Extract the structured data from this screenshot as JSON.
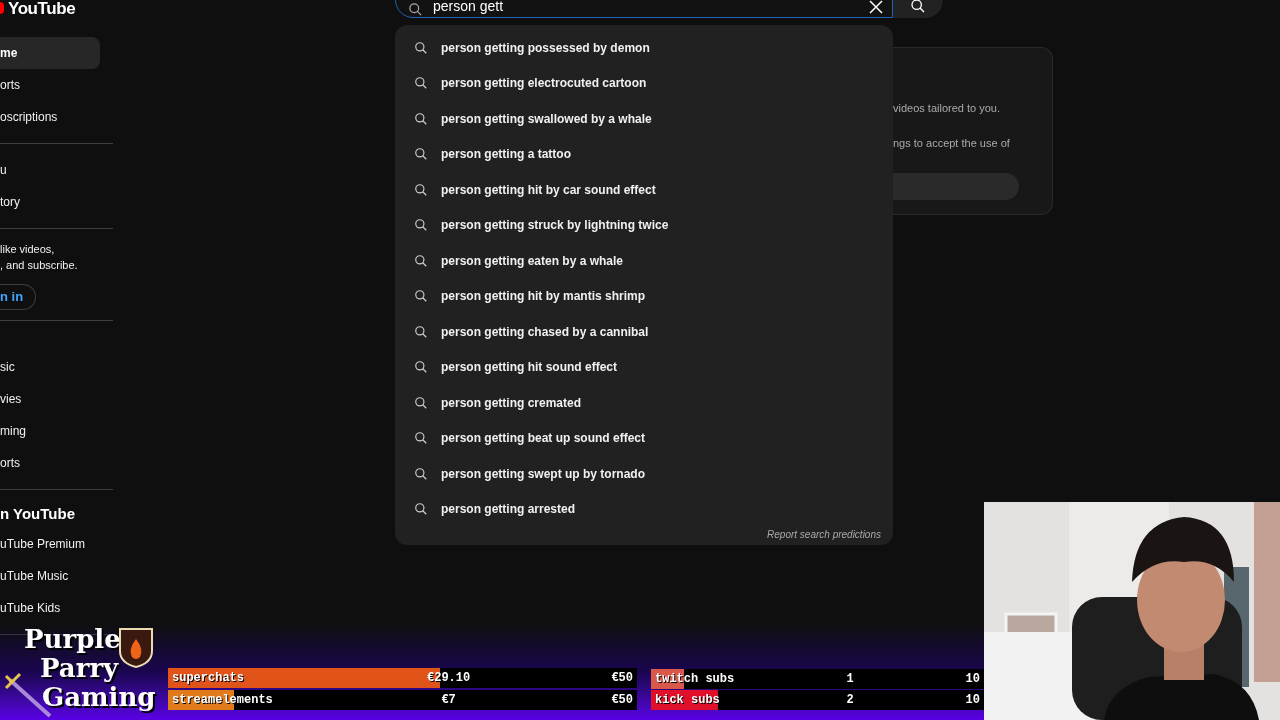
{
  "logo": {
    "text": "YouTube"
  },
  "sidebar": {
    "sections": [
      {
        "rows": [
          {
            "kind": "item",
            "label": "me",
            "selected": true
          },
          {
            "kind": "item",
            "label": "orts",
            "selected": false
          },
          {
            "kind": "item",
            "label": "oscriptions",
            "selected": false
          }
        ]
      },
      {
        "rows": [
          {
            "kind": "item",
            "label": "u",
            "selected": false
          },
          {
            "kind": "item",
            "label": "tory",
            "selected": false
          }
        ]
      },
      {
        "rows": [
          {
            "kind": "prompt",
            "label": "like videos,\n, and subscribe."
          },
          {
            "kind": "button",
            "label": "n in"
          }
        ]
      },
      {
        "rows": [
          {
            "kind": "item",
            "label": "sic",
            "selected": false
          },
          {
            "kind": "item",
            "label": "vies",
            "selected": false
          },
          {
            "kind": "item",
            "label": "ming",
            "selected": false
          },
          {
            "kind": "item",
            "label": "orts",
            "selected": false
          }
        ]
      },
      {
        "rows": [
          {
            "kind": "heading",
            "label": "n YouTube"
          },
          {
            "kind": "item",
            "label": "uTube Premium",
            "selected": false
          },
          {
            "kind": "item",
            "label": "uTube Music",
            "selected": false
          },
          {
            "kind": "item",
            "label": "uTube Kids",
            "selected": false
          }
        ]
      }
    ]
  },
  "search": {
    "value": "person gett"
  },
  "suggestions": [
    {
      "text": "person getting possessed by demon"
    },
    {
      "text": "person getting electrocuted cartoon"
    },
    {
      "text": "person getting swallowed by a whale"
    },
    {
      "text": "person getting a tattoo"
    },
    {
      "text": "person getting hit by car sound effect"
    },
    {
      "text": "person getting struck by lightning twice"
    },
    {
      "text": "person getting eaten by a whale"
    },
    {
      "text": "person getting hit by mantis shrimp"
    },
    {
      "text": "person getting chased by a cannibal"
    },
    {
      "text": "person getting hit sound effect"
    },
    {
      "text": "person getting cremated"
    },
    {
      "text": "person getting beat up sound effect"
    },
    {
      "text": "person getting swept up by tornado"
    },
    {
      "text": "person getting arrested"
    }
  ],
  "report_link": "Report search predictions",
  "card": {
    "lines": [
      "videos tailored to you.",
      "ngs to accept the use of"
    ]
  },
  "overlay": {
    "logo_lines": [
      "Purple",
      "Parry",
      "Gaming"
    ],
    "donation_bars": [
      {
        "label": "superchats",
        "amount": "€29.10",
        "target": "€50",
        "level": 0.58,
        "color": "#e0541a"
      },
      {
        "label": "streamelements",
        "amount": "€7",
        "target": "€50",
        "level": 0.14,
        "color": "#e07a1a"
      }
    ],
    "sub_bars": [
      {
        "label": "twitch subs",
        "amount": "1",
        "target": "10",
        "level": 0.1,
        "color": "#d9584a"
      },
      {
        "label": "kick subs",
        "amount": "2",
        "target": "10",
        "level": 0.2,
        "color": "#e0102a"
      }
    ]
  }
}
